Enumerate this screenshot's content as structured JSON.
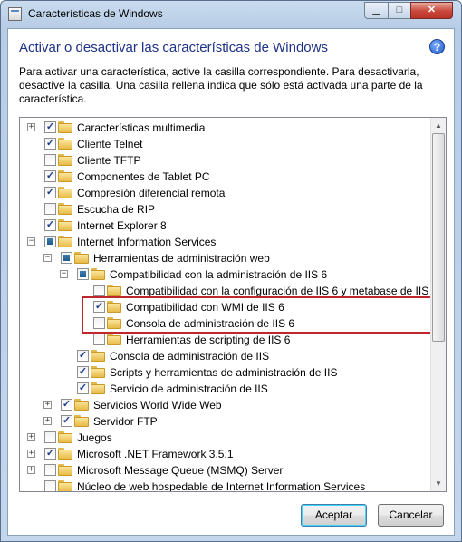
{
  "window": {
    "title": "Características de Windows",
    "minimize_glyph": "▁",
    "maximize_glyph": "□",
    "close_glyph": "✕"
  },
  "header": {
    "heading": "Activar o desactivar las características de Windows",
    "help_glyph": "?",
    "description": "Para activar una característica, active la casilla correspondiente. Para desactivarla, desactive la casilla. Una casilla rellena indica que sólo está activada una parte de la característica."
  },
  "tree": [
    {
      "label": "Características multimedia",
      "state": "checked",
      "expander": "+",
      "level": 0
    },
    {
      "label": "Cliente Telnet",
      "state": "checked",
      "expander": "",
      "level": 0
    },
    {
      "label": "Cliente TFTP",
      "state": "unchecked",
      "expander": "",
      "level": 0
    },
    {
      "label": "Componentes de Tablet PC",
      "state": "checked",
      "expander": "",
      "level": 0
    },
    {
      "label": "Compresión diferencial remota",
      "state": "checked",
      "expander": "",
      "level": 0
    },
    {
      "label": "Escucha de RIP",
      "state": "unchecked",
      "expander": "",
      "level": 0
    },
    {
      "label": "Internet Explorer 8",
      "state": "checked",
      "expander": "",
      "level": 0
    },
    {
      "label": "Internet Information Services",
      "state": "partial",
      "expander": "−",
      "level": 0
    },
    {
      "label": "Herramientas de administración web",
      "state": "partial",
      "expander": "−",
      "level": 1
    },
    {
      "label": "Compatibilidad con la administración de IIS 6",
      "state": "partial",
      "expander": "−",
      "level": 2
    },
    {
      "label": "Compatibilidad con la configuración de IIS 6 y metabase de IIS",
      "state": "unchecked",
      "expander": "",
      "level": 3
    },
    {
      "label": "Compatibilidad con WMI de IIS 6",
      "state": "checked",
      "expander": "",
      "level": 3
    },
    {
      "label": "Consola de administración de IIS 6",
      "state": "unchecked",
      "expander": "",
      "level": 3
    },
    {
      "label": "Herramientas de scripting de IIS 6",
      "state": "unchecked",
      "expander": "",
      "level": 3
    },
    {
      "label": "Consola de administración de IIS",
      "state": "checked",
      "expander": "",
      "level": 2
    },
    {
      "label": "Scripts y herramientas de administración de IIS",
      "state": "checked",
      "expander": "",
      "level": 2
    },
    {
      "label": "Servicio de administración de IIS",
      "state": "checked",
      "expander": "",
      "level": 2
    },
    {
      "label": "Servicios World Wide Web",
      "state": "checked",
      "expander": "+",
      "level": 1
    },
    {
      "label": "Servidor FTP",
      "state": "checked",
      "expander": "+",
      "level": 1
    },
    {
      "label": "Juegos",
      "state": "unchecked",
      "expander": "+",
      "level": 0
    },
    {
      "label": "Microsoft .NET Framework 3.5.1",
      "state": "checked",
      "expander": "+",
      "level": 0
    },
    {
      "label": "Microsoft Message Queue (MSMQ) Server",
      "state": "unchecked",
      "expander": "+",
      "level": 0
    },
    {
      "label": "Núcleo de web hospedable de Internet Information Services",
      "state": "unchecked",
      "expander": "",
      "level": 0
    }
  ],
  "scrollbar": {
    "up_glyph": "▲",
    "down_glyph": "▼"
  },
  "buttons": {
    "ok": "Aceptar",
    "cancel": "Cancelar"
  }
}
